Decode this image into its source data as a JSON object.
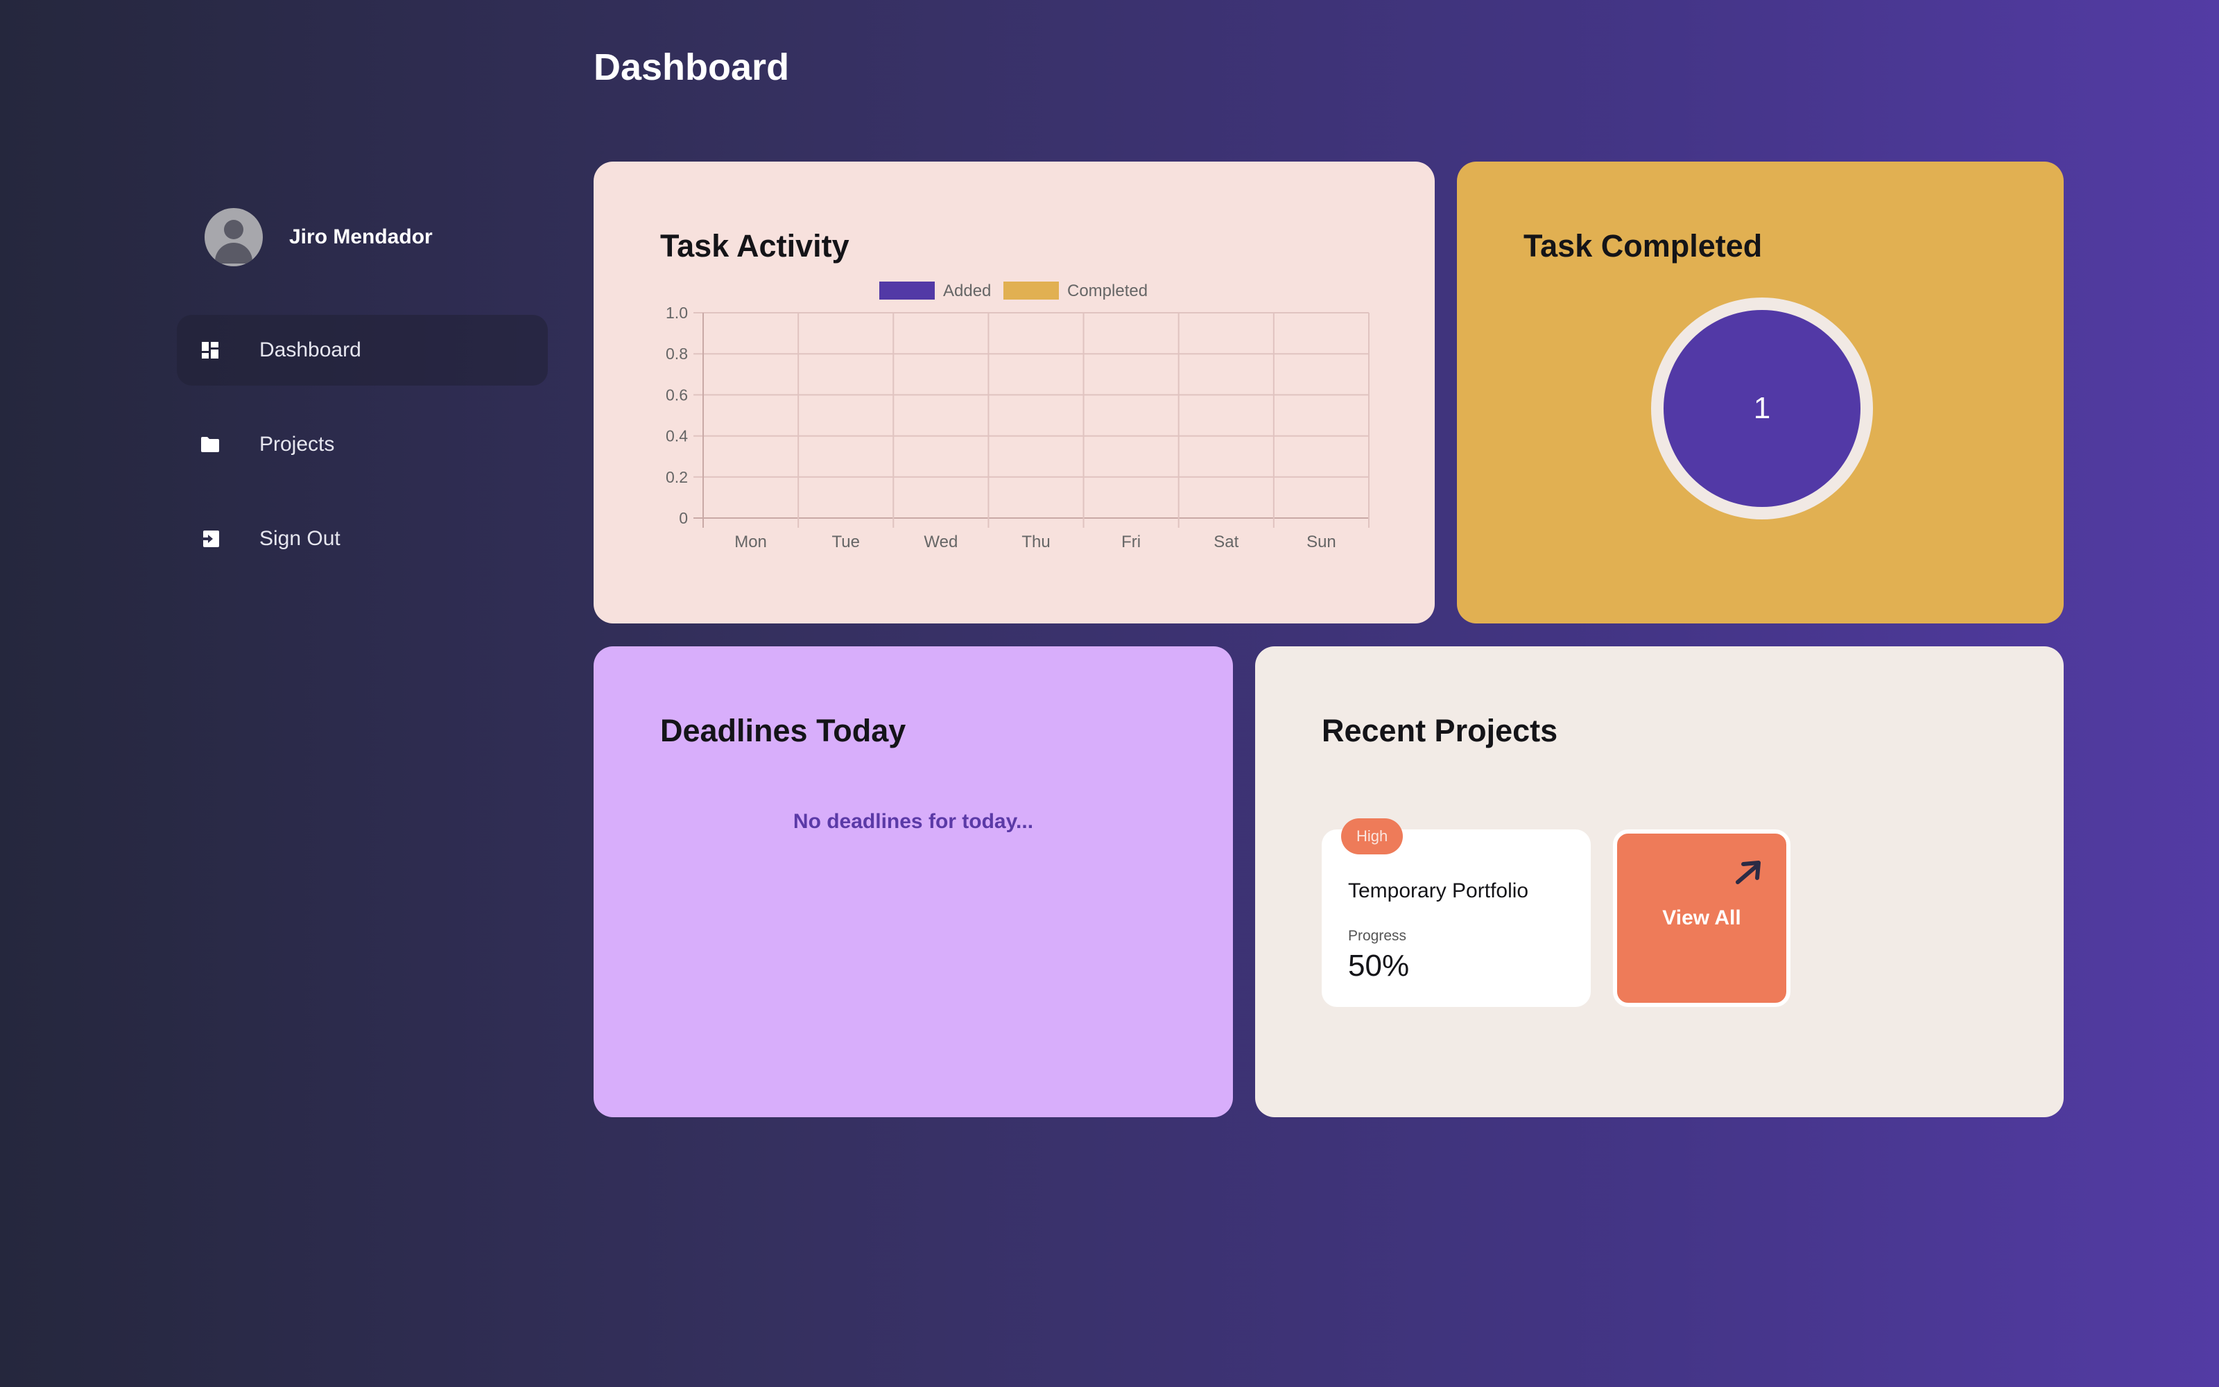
{
  "page": {
    "title": "Dashboard"
  },
  "sidebar": {
    "user_name": "Jiro Mendador",
    "items": [
      {
        "label": "Dashboard",
        "icon": "dashboard-icon",
        "active": true
      },
      {
        "label": "Projects",
        "icon": "folder-icon",
        "active": false
      },
      {
        "label": "Sign Out",
        "icon": "sign-out-icon",
        "active": false
      }
    ]
  },
  "task_activity": {
    "title": "Task Activity"
  },
  "task_completed": {
    "title": "Task Completed",
    "count": "1"
  },
  "deadlines": {
    "title": "Deadlines Today",
    "empty_text": "No deadlines for today..."
  },
  "recent_projects": {
    "title": "Recent Projects",
    "projects": [
      {
        "priority": "High",
        "name": "Temporary Portfolio",
        "progress_label": "Progress",
        "progress": "50%"
      }
    ],
    "view_all_label": "View All"
  },
  "colors": {
    "added": "#5239a6",
    "completed": "#e1b052",
    "activity_card": "#f7e1dd",
    "completed_card": "#e1b052",
    "deadlines_card": "#d8aefb",
    "recent_card": "#f2ebe6",
    "accent_orange": "#ee7b59"
  },
  "chart_data": {
    "type": "bar",
    "categories": [
      "Mon",
      "Tue",
      "Wed",
      "Thu",
      "Fri",
      "Sat",
      "Sun"
    ],
    "series": [
      {
        "name": "Added",
        "color": "#5239a6",
        "values": [
          0,
          0,
          0,
          0,
          0,
          0,
          0
        ]
      },
      {
        "name": "Completed",
        "color": "#e1b052",
        "values": [
          0,
          0,
          0,
          0,
          0,
          0,
          0
        ]
      }
    ],
    "yticks": [
      "0",
      "0.2",
      "0.4",
      "0.6",
      "0.8",
      "1.0"
    ],
    "ylim": [
      0,
      1
    ],
    "grid": true,
    "legend": "top-center"
  }
}
